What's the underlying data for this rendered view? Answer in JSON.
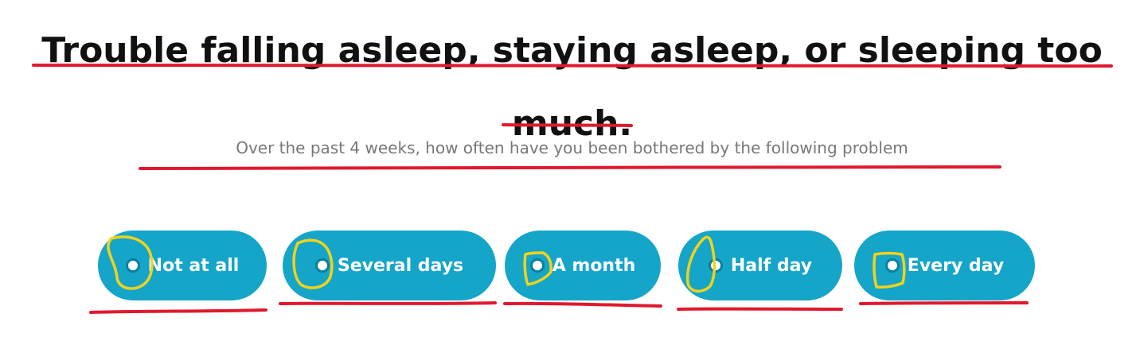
{
  "question": {
    "title": "Trouble falling asleep, staying asleep, or sleeping too much.",
    "subtitle": "Over the past 4 weeks, how often have you been bothered by the following problem"
  },
  "options": [
    {
      "label": "Not at all",
      "selected": false
    },
    {
      "label": "Several days",
      "selected": false
    },
    {
      "label": "A month",
      "selected": false
    },
    {
      "label": "Half day",
      "selected": false
    },
    {
      "label": "Every day",
      "selected": false
    }
  ],
  "colors": {
    "button": "#14a5c9",
    "button_text": "#ffffff",
    "title": "#111111",
    "subtitle": "#777777",
    "underline_annotation": "#e0192e",
    "circle_annotation": "#f2d21b"
  }
}
